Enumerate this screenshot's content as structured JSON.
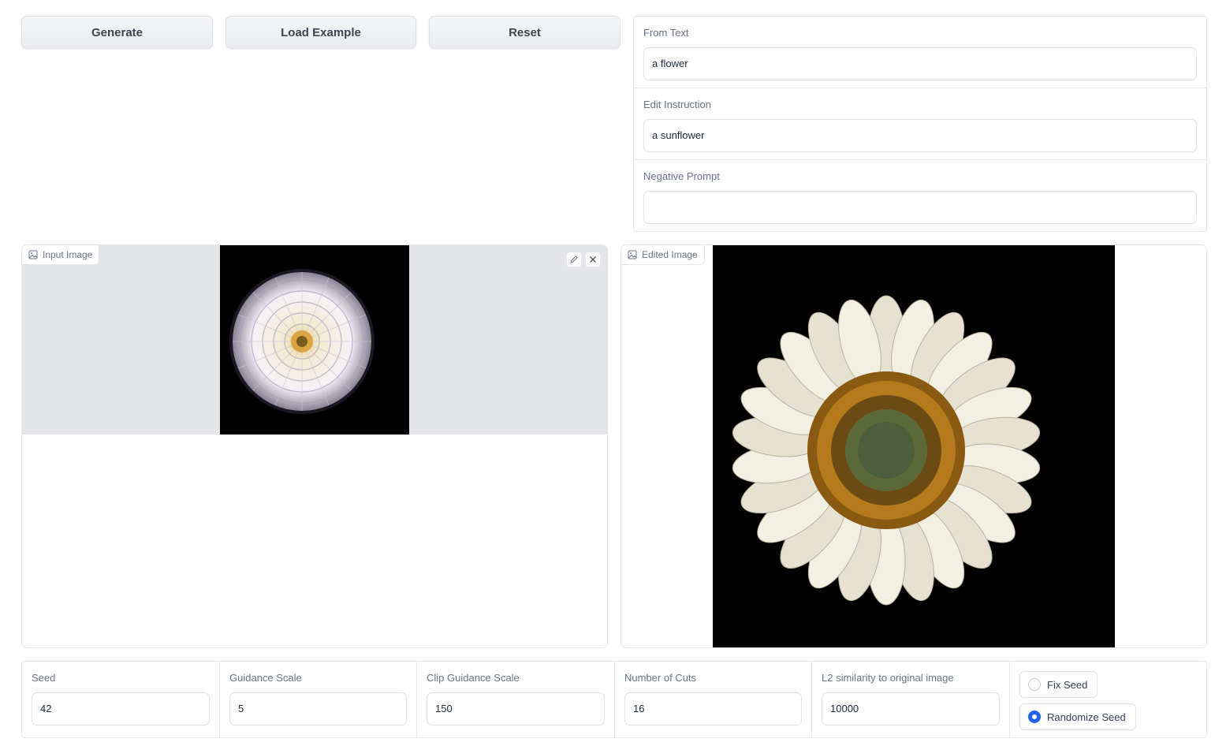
{
  "buttons": {
    "generate": "Generate",
    "load_example": "Load Example",
    "reset": "Reset"
  },
  "text_inputs": {
    "from_text": {
      "label": "From Text",
      "value": "a flower"
    },
    "edit_instruction": {
      "label": "Edit Instruction",
      "value": "a sunflower"
    },
    "negative_prompt": {
      "label": "Negative Prompt",
      "value": ""
    }
  },
  "input_image": {
    "label": "Input Image",
    "icon": "image-icon",
    "tools": [
      "edit-icon",
      "close-icon"
    ]
  },
  "edited_image": {
    "label": "Edited Image",
    "icon": "image-icon"
  },
  "params": {
    "seed": {
      "label": "Seed",
      "value": "42"
    },
    "guidance_scale": {
      "label": "Guidance Scale",
      "value": "5"
    },
    "clip_guidance_scale": {
      "label": "Clip Guidance Scale",
      "value": "150"
    },
    "number_of_cuts": {
      "label": "Number of Cuts",
      "value": "16"
    },
    "l2_similarity": {
      "label": "L2 similarity to original image",
      "value": "10000"
    }
  },
  "seed_mode": {
    "options": [
      "Fix Seed",
      "Randomize Seed"
    ],
    "selected": "Randomize Seed"
  },
  "colors": {
    "accent": "#2563eb",
    "panel_border": "#e5e7eb",
    "image_bg": "#e4e6ea"
  }
}
